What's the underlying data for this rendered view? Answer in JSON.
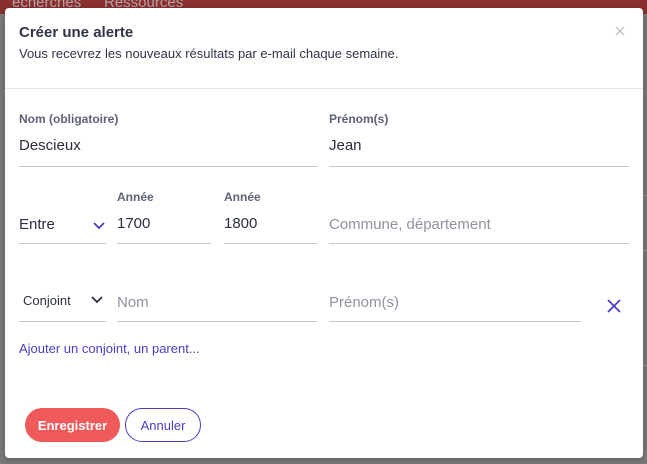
{
  "background": {
    "topbar_items": [
      "echerches",
      "Ressources"
    ]
  },
  "modal": {
    "title": "Créer une alerte",
    "subtitle": "Vous recevrez les nouveaux résultats par e-mail chaque semaine.",
    "close_icon": "close-icon"
  },
  "form": {
    "nom": {
      "label": "Nom (obligatoire)",
      "value": "Descieux"
    },
    "prenom": {
      "label": "Prénom(s)",
      "value": "Jean"
    },
    "range": {
      "selected": "Entre"
    },
    "year_from": {
      "label": "Année",
      "value": "1700"
    },
    "year_to": {
      "label": "Année",
      "value": "1800"
    },
    "commune": {
      "placeholder": "Commune, département"
    },
    "relation": {
      "selected": "Conjoint"
    },
    "relation_nom": {
      "placeholder": "Nom"
    },
    "relation_prenom": {
      "placeholder": "Prénom(s)"
    },
    "remove_icon": "remove-icon"
  },
  "add_link": "Ajouter un conjoint, un parent...",
  "buttons": {
    "save": "Enregistrer",
    "cancel": "Annuler"
  },
  "colors": {
    "primary_button": "#f05a5b",
    "accent": "#4a3fbf",
    "text": "#2a2f3f"
  }
}
